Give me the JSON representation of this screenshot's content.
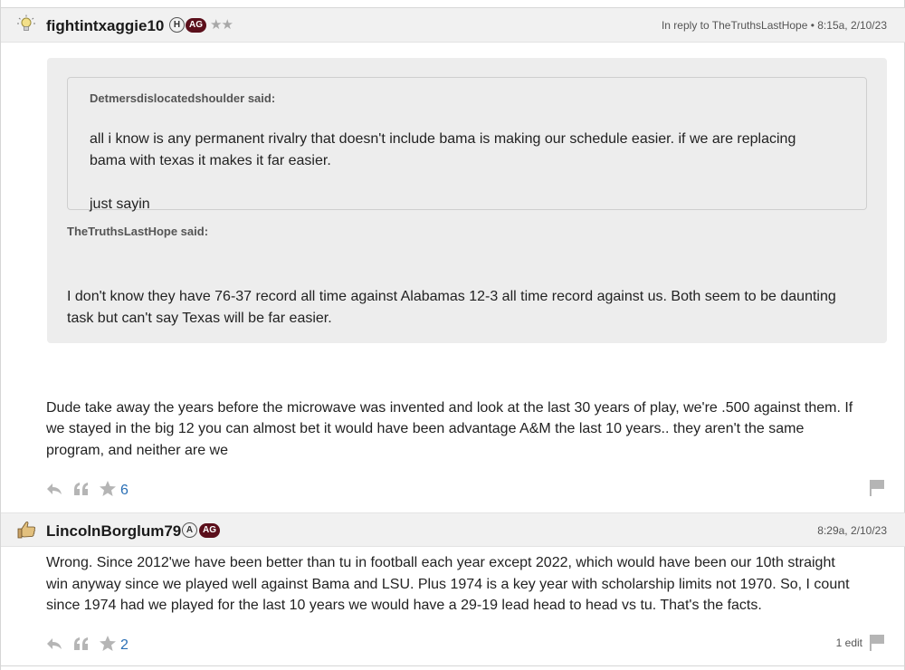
{
  "posts": [
    {
      "username": "fightintxaggie10",
      "badge_h": "H",
      "badge_ag": "AG",
      "stars": "★★",
      "meta": "In reply to TheTruthsLastHope • 8:15a, 2/10/23",
      "avatar": "lightbulb-icon",
      "nested_quote": {
        "author_said": "Detmersdislocatedshoulder said:",
        "line1": "all i know is any permanent rivalry that doesn't include bama is making our schedule easier. if we are replacing",
        "line2": "bama with texas it makes it far easier.",
        "line3": "just sayin"
      },
      "quote": {
        "author_said": "TheTruthsLastHope said:",
        "line1": "I don't know they have 76-37 record all time against Alabamas 12-3 all time record against us. Both seem to be daunting",
        "line2": "task but can't say Texas will be far easier."
      },
      "body": {
        "line1": "Dude take away the years before the microwave was invented and look at the last 30 years of play, we're .500 against them. If",
        "line2": "we stayed in the big 12 you can almost bet it would have been advantage A&M the last 10 years.. they aren't the same",
        "line3": "program, and neither are we"
      },
      "like_count": "6"
    },
    {
      "username": "LincolnBorglum79",
      "badge_a": "A",
      "badge_ag": "AG",
      "meta": "8:29a, 2/10/23",
      "avatar": "thumbs-up-icon",
      "body": {
        "line1": "Wrong. Since 2012'we have been better than tu in football each year except 2022, which would have been our 10th straight",
        "line2": "win anyway since we played well against Bama and LSU. Plus 1974 is a key year with scholarship limits not 1970. So, I count",
        "line3": "since 1974 had we played for the last 10 years we would have a 29-19 lead head to head vs tu. That's the facts."
      },
      "like_count": "2",
      "edit_count": "1 edit"
    }
  ],
  "colors": {
    "header_bg": "#f1f1f1",
    "ag_badge": "#5b0f1b",
    "like_count": "#2a6fb5",
    "icon_gray": "#b5b5b5"
  }
}
